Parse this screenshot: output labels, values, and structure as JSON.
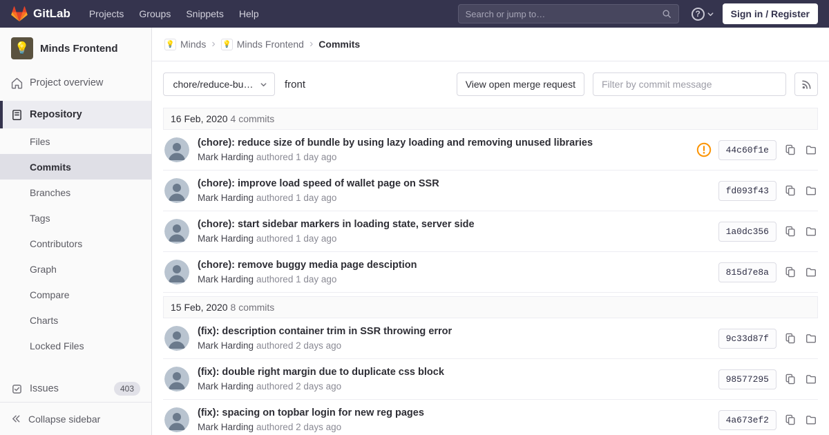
{
  "navbar": {
    "logo_text": "GitLab",
    "menu": [
      "Projects",
      "Groups",
      "Snippets",
      "Help"
    ],
    "search_placeholder": "Search or jump to…",
    "sign_in_label": "Sign in / Register"
  },
  "sidebar": {
    "project_name": "Minds Frontend",
    "items": {
      "project_overview": "Project overview",
      "repository": "Repository",
      "issues": "Issues",
      "issues_count": "403",
      "collapse_label": "Collapse sidebar"
    },
    "repository_children": [
      "Files",
      "Commits",
      "Branches",
      "Tags",
      "Contributors",
      "Graph",
      "Compare",
      "Charts",
      "Locked Files"
    ],
    "active_child": "Commits"
  },
  "breadcrumb": {
    "group": "Minds",
    "project": "Minds Frontend",
    "current": "Commits"
  },
  "toolbar": {
    "branch_dropdown_value": "chore/reduce-bu…",
    "ref_path": "front",
    "merge_request_button": "View open merge request",
    "filter_placeholder": "Filter by commit message"
  },
  "commit_groups": [
    {
      "date": "16 Feb, 2020",
      "count": "4 commits",
      "commits": [
        {
          "title": "(chore): reduce size of bundle by using lazy loading and removing unused libraries",
          "author": "Mark Harding",
          "meta": "authored 1 day ago",
          "sha": "44c60f1e",
          "warning": true
        },
        {
          "title": "(chore): improve load speed of wallet page on SSR",
          "author": "Mark Harding",
          "meta": "authored 1 day ago",
          "sha": "fd093f43",
          "warning": false
        },
        {
          "title": "(chore): start sidebar markers in loading state, server side",
          "author": "Mark Harding",
          "meta": "authored 1 day ago",
          "sha": "1a0dc356",
          "warning": false
        },
        {
          "title": "(chore): remove buggy media page desciption",
          "author": "Mark Harding",
          "meta": "authored 1 day ago",
          "sha": "815d7e8a",
          "warning": false
        }
      ]
    },
    {
      "date": "15 Feb, 2020",
      "count": "8 commits",
      "commits": [
        {
          "title": "(fix): description container trim in SSR throwing error",
          "author": "Mark Harding",
          "meta": "authored 2 days ago",
          "sha": "9c33d87f",
          "warning": false
        },
        {
          "title": "(fix): double right margin due to duplicate css block",
          "author": "Mark Harding",
          "meta": "authored 2 days ago",
          "sha": "98577295",
          "warning": false
        },
        {
          "title": "(fix): spacing on topbar login for new reg pages",
          "author": "Mark Harding",
          "meta": "authored 2 days ago",
          "sha": "4a673ef2",
          "warning": false
        }
      ]
    }
  ],
  "colors": {
    "navbar_bg": "#35344e",
    "brand_orange": "#fc6d26",
    "warning_orange": "#fc9403"
  }
}
